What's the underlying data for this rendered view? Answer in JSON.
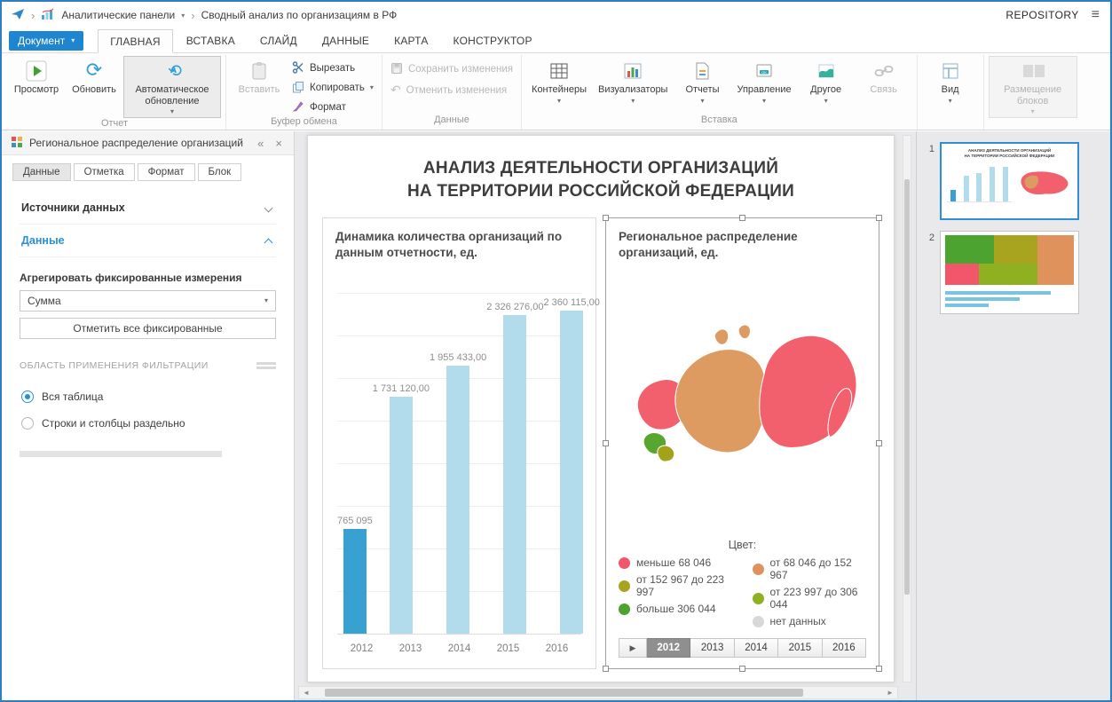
{
  "topbar": {
    "breadcrumb_section": "Аналитические панели",
    "breadcrumb_document": "Сводный анализ по организациям в РФ",
    "repository": "REPOSITORY"
  },
  "ribbon": {
    "document_button": "Документ",
    "tabs": [
      "ГЛАВНАЯ",
      "ВСТАВКА",
      "СЛАЙД",
      "ДАННЫЕ",
      "КАРТА",
      "КОНСТРУКТОР"
    ],
    "active_tab": "ГЛАВНАЯ",
    "report_group": {
      "label": "Отчет",
      "preview": "Просмотр",
      "refresh": "Обновить",
      "auto_refresh": "Автоматическое обновление"
    },
    "clipboard_group": {
      "label": "Буфер обмена",
      "paste": "Вставить",
      "cut": "Вырезать",
      "copy": "Копировать",
      "format": "Формат"
    },
    "data_group": {
      "label": "Данные",
      "save": "Сохранить изменения",
      "undo": "Отменить изменения"
    },
    "insert_group": {
      "label": "Вставка",
      "containers": "Контейнеры",
      "visualizers": "Визуализаторы",
      "reports": "Отчеты",
      "management": "Управление",
      "other": "Другое",
      "link": "Связь"
    },
    "view_button": "Вид",
    "layout_button": "Размещение блоков"
  },
  "sidebar": {
    "title": "Региональное распределение организаций",
    "tabs": [
      "Данные",
      "Отметка",
      "Формат",
      "Блок"
    ],
    "active_tab": "Данные",
    "sources_section": "Источники данных",
    "data_section": "Данные",
    "aggregate_label": "Агрегировать фиксированные измерения",
    "aggregate_value": "Сумма",
    "mark_all_button": "Отметить все фиксированные",
    "filter_area_label": "ОБЛАСТЬ ПРИМЕНЕНИЯ ФИЛЬТРАЦИИ",
    "radio_all": "Вся таблица",
    "radio_separate": "Строки и столбцы раздельно",
    "selected_radio": "Вся таблица"
  },
  "slide": {
    "title_line1": "АНАЛИЗ ДЕЯТЕЛЬНОСТИ ОРГАНИЗАЦИЙ",
    "title_line2": "НА ТЕРРИТОРИИ РОССИЙСКОЙ ФЕДЕРАЦИИ"
  },
  "chart_data": [
    {
      "type": "bar",
      "title": "Динамика количества организаций по данным отчетности, ед.",
      "title_line1": "Динамика количества организаций по",
      "title_line2": "данным отчетности, ед.",
      "categories": [
        "2012",
        "2013",
        "2014",
        "2015",
        "2016"
      ],
      "values": [
        765095,
        1731120,
        1955433,
        2326276,
        2360115
      ],
      "value_labels": [
        "765 095",
        "1 731 120,00",
        "1 955 433,00",
        "2 326 276,00",
        "2 360 115,00"
      ],
      "selected_category": "2012",
      "bar_color": "#b2dbec",
      "selected_bar_color": "#38a1d1",
      "xlabel": "",
      "ylabel": "",
      "ylim": [
        0,
        2400000
      ],
      "grid": true,
      "legend_position": "none"
    },
    {
      "type": "heatmap",
      "subtype": "choropleth-map-of-russia",
      "title": "Региональное распределение организаций, ед.",
      "title_line1": "Региональное распределение",
      "title_line2": "организаций, ед.",
      "legend_title": "Цвет:",
      "classes": [
        {
          "label": "меньше 68 046",
          "color": "#f2566b"
        },
        {
          "label": "от 68 046 до 152 967",
          "color": "#df925c"
        },
        {
          "label": "от 152 967 до 223 997",
          "color": "#a8a41f"
        },
        {
          "label": "от 223 997 до 306 044",
          "color": "#8fb021"
        },
        {
          "label": "больше 306 044",
          "color": "#4da32f"
        },
        {
          "label": "нет данных",
          "color": "#d8d8d8"
        }
      ],
      "map_colors": {
        "low": "#f2606d",
        "mid": "#dd9a61",
        "olive": "#a2a318",
        "green": "#57a62f"
      },
      "years": [
        "2012",
        "2013",
        "2014",
        "2015",
        "2016"
      ],
      "selected_year": "2012"
    }
  ],
  "thumbnails": {
    "first_number": "1",
    "second_number": "2"
  }
}
